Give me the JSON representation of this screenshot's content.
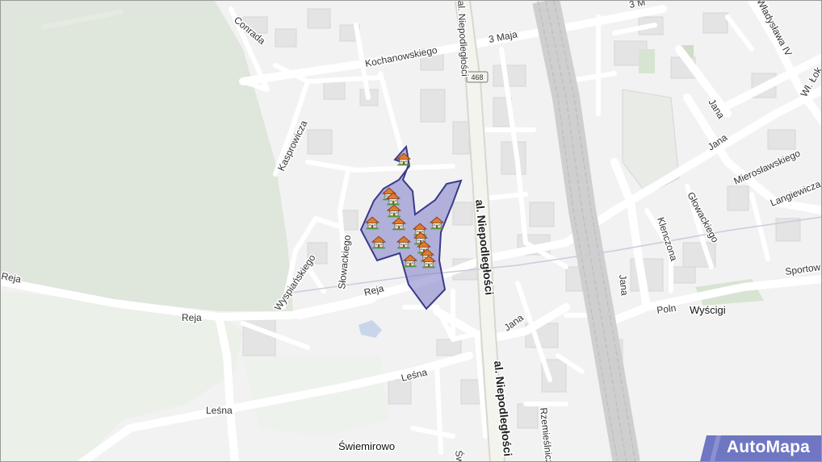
{
  "map": {
    "streets": {
      "conrada": "Conrada",
      "kochanowskiego": "Kochanowskiego",
      "trzeciego_maja": "3 Maja",
      "trzeciego_maja_top": "3 M",
      "kasprowicza": "Kasprowicza",
      "slowackiego": "Słowackiego",
      "wyspianskiego": "Wyspiańskiego",
      "reja_left": "Reja",
      "reja_mid": "Reja",
      "reja_center": "Reja",
      "lesna_center": "Leśna",
      "lesna_left": "Leśna",
      "niepodleglosci_top": "al. Niepodległości",
      "niepodleglosci_mid": "al. Niepodległości",
      "niepodleglosci_bottom": "al. Niepodległości",
      "route_shield": "468",
      "jana_bottom": "Jana",
      "jana_rail": "Jana",
      "jana_upper": "Jana",
      "jana_right": "Jana",
      "wladyslawa": "Władysława IV",
      "wl_lok": "Wł. Łok",
      "mieroslawskiego": "Mierosławskiego",
      "langiewicza": "Langiewicza",
      "glowackiego": "Głowackiego",
      "klenczona": "Klenczona",
      "sportowa": "Sportow",
      "polna": "Poln",
      "rzemieslnicza": "Rzemieślnicz",
      "swiemirowo_street": "Św"
    },
    "places": {
      "wyscigi": "Wyścigi",
      "swiemirowo": "Świemirowo"
    },
    "marker_icon": "house-icon",
    "area_color": "#8080c8",
    "area_outline": "#3a3a8c"
  },
  "branding": {
    "logo_text": "AutoMapa",
    "logo_color": "#6f76c2"
  }
}
